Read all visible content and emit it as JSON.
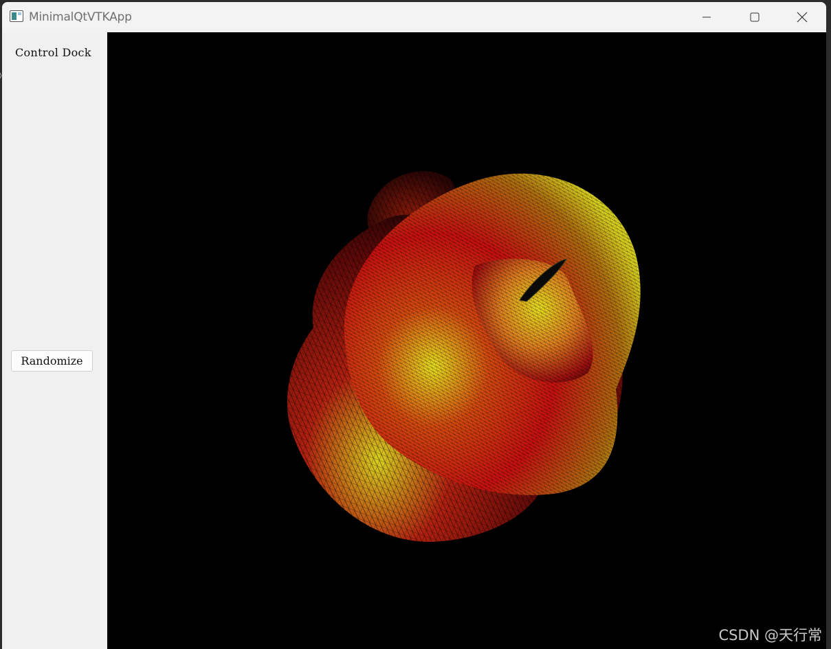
{
  "window": {
    "title": "MinimalQtVTKApp",
    "controls": {
      "minimize": "minimize-icon",
      "maximize": "maximize-icon",
      "close": "close-icon"
    }
  },
  "dock": {
    "title": "Control Dock",
    "randomize_label": "Randomize"
  },
  "viewport": {
    "background": "#000000",
    "surface_colors": [
      "#c81010",
      "#e8e020"
    ]
  },
  "watermark": "CSDN @天行常"
}
